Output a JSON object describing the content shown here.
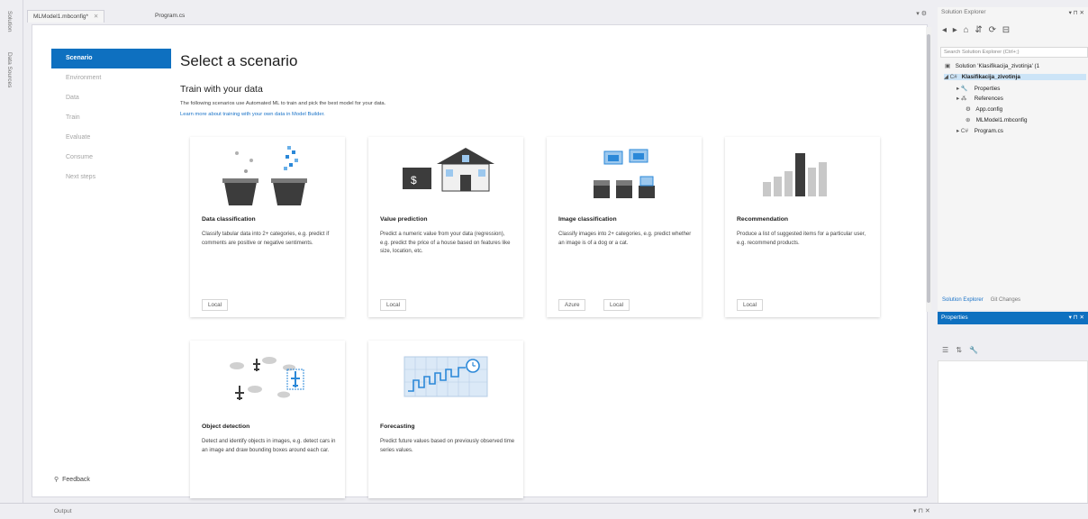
{
  "left_strip": {
    "tab1": "Solution",
    "tab2": "Data Sources"
  },
  "tabs": [
    {
      "label": "MLModel1.mbconfig*",
      "close": "✕"
    },
    {
      "label": "Program.cs",
      "close": ""
    }
  ],
  "tab_controls": "▾ ⚙",
  "nav": [
    "Scenario",
    "Environment",
    "Data",
    "Train",
    "Evaluate",
    "Consume",
    "Next steps"
  ],
  "feedback": {
    "label": "Feedback",
    "icon": "feedback-icon"
  },
  "header": {
    "title": "Select a scenario",
    "subtitle": "Train with your data",
    "description": "The following scenarios use Automated ML to train and pick the best model for your data.",
    "learn_link": "Learn more about training with your own data in Model Builder."
  },
  "cards": [
    {
      "title": "Data classification",
      "desc": "Classify tabular data into 2+ categories, e.g. predict if comments are positive or negative sentiments.",
      "envs": [
        "Local"
      ]
    },
    {
      "title": "Value prediction",
      "desc": "Predict a numeric value from your data (regression), e.g. predict the price of a house based on features like size, location, etc.",
      "envs": [
        "Local"
      ]
    },
    {
      "title": "Image classification",
      "desc": "Classify images into 2+ categories, e.g. predict whether an image is of a dog or a cat.",
      "envs": [
        "Azure",
        "Local"
      ]
    },
    {
      "title": "Recommendation",
      "desc": "Produce a list of suggested items for a particular user, e.g. recommend products.",
      "envs": [
        "Local"
      ]
    },
    {
      "title": "Object detection",
      "desc": "Detect and identify objects in images, e.g. detect cars in an image and draw bounding boxes around each car.",
      "envs": []
    },
    {
      "title": "Forecasting",
      "desc": "Predict future values based on previously observed time series values.",
      "envs": []
    }
  ],
  "solution_explorer": {
    "title": "Solution Explorer",
    "controls": "▾ ⊓ ✕",
    "toolbar": "◂ ▸ ⌂ ⇵ ⟳ ⊟",
    "search_placeholder": "Search Solution Explorer (Ctrl+;)",
    "tree": [
      {
        "icon": "▣",
        "label": "Solution 'Klasifikacija_zivotinja' (1"
      },
      {
        "icon": "◢ C#",
        "label": "Klasifikacija_zivotinja"
      },
      {
        "icon": "▸ 🔧",
        "label": "Properties"
      },
      {
        "icon": "▸ ⁂",
        "label": "References"
      },
      {
        "icon": "⚙",
        "label": "App.config"
      },
      {
        "icon": "⊛",
        "label": "MLModel1.mbconfig"
      },
      {
        "icon": "▸ C#",
        "label": "Program.cs"
      }
    ],
    "tabs": [
      "Solution Explorer",
      "Git Changes"
    ]
  },
  "properties": {
    "title": "Properties",
    "controls": "▾ ⊓ ✕",
    "toolbar": "☰ ⇅ 🔧"
  },
  "output": {
    "label": "Output",
    "controls": "▾ ⊓ ✕"
  },
  "colors": {
    "accent": "#0e70c0",
    "link": "#1a73c8"
  }
}
